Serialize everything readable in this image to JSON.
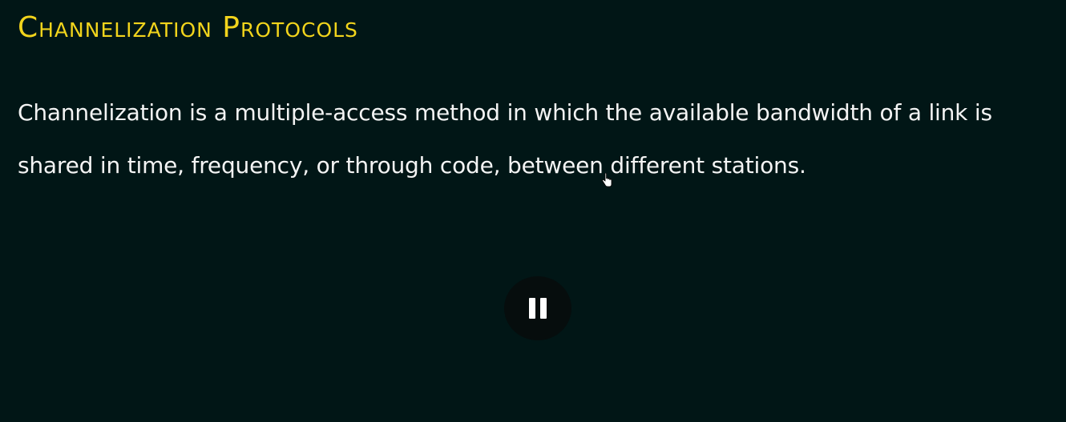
{
  "slide": {
    "title": "Channelization Protocols",
    "body": "Channelization is a multiple-access method in which the available bandwidth of a link is shared in time, frequency, or through code, between different stations."
  },
  "player": {
    "pause_icon": "pause-icon",
    "cursor_icon": "hand-pointer-icon"
  },
  "colors": {
    "background": "#011616",
    "title": "#f2d41c",
    "body_text": "#f4f4f4",
    "pause_button_bg": "#060d0d"
  }
}
